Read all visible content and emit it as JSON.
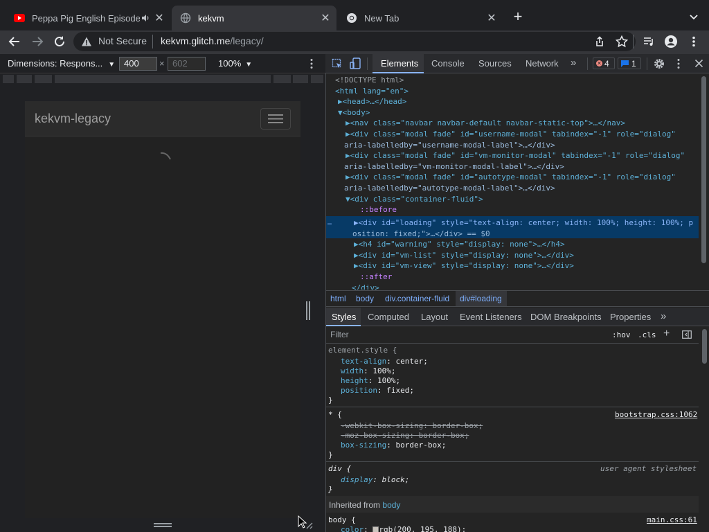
{
  "tabs": [
    {
      "title": "Peppa Pig English Episode",
      "icon": "youtube-icon"
    },
    {
      "title": "kekvm",
      "icon": "globe-icon"
    },
    {
      "title": "New Tab",
      "icon": "chrome-icon"
    }
  ],
  "address": {
    "security": "Not Secure",
    "host": "kekvm.glitch.me",
    "path": "/legacy/"
  },
  "device_toolbar": {
    "dimensions_label": "Dimensions: Respons...",
    "width": "400",
    "height_placeholder": "602",
    "times": "×",
    "zoom": "100%"
  },
  "page": {
    "brand": "kekvm-legacy"
  },
  "devtools": {
    "tabs": [
      "Elements",
      "Console",
      "Sources",
      "Network"
    ],
    "more": "»",
    "errors_count": "4",
    "messages_count": "1",
    "dom_lines": [
      {
        "text": "<!DOCTYPE html>"
      },
      {
        "text": "<html lang=\"en\">"
      },
      {
        "text": "▶<head>…</head>"
      },
      {
        "text": "▼<body>"
      },
      {
        "text": "▶<nav class=\"navbar navbar-default navbar-static-top\">…</nav>"
      },
      {
        "text": "▶<div class=\"modal fade\" id=\"username-modal\" tabindex=\"-1\" role=\"dialog\""
      },
      {
        "text": "aria-labelledby=\"username-modal-label\">…</div>"
      },
      {
        "text": "▶<div class=\"modal fade\" id=\"vm-monitor-modal\" tabindex=\"-1\" role=\"dialog\""
      },
      {
        "text": "aria-labelledby=\"vm-monitor-modal-label\">…</div>"
      },
      {
        "text": "▶<div class=\"modal fade\" id=\"autotype-modal\" tabindex=\"-1\" role=\"dialog\""
      },
      {
        "text": "aria-labelledby=\"autotype-modal-label\">…</div>"
      },
      {
        "text": "▼<div class=\"container-fluid\">"
      },
      {
        "text": "::before"
      },
      {
        "text": "▶<div id=\"loading\" style=\"text-align: center; width: 100%; height: 100%; p"
      },
      {
        "text": "osition: fixed;\">…</div> == $0"
      },
      {
        "text": "▶<h4 id=\"warning\" style=\"display: none\">…</h4>"
      },
      {
        "text": "▶<div id=\"vm-list\" style=\"display: none\">…</div>"
      },
      {
        "text": "▶<div id=\"vm-view\" style=\"display: none\">…</div>"
      },
      {
        "text": "::after"
      },
      {
        "text": "</div>"
      }
    ],
    "breadcrumbs": [
      "html",
      "body",
      "div.container-fluid",
      "div#loading"
    ],
    "subtabs": [
      "Styles",
      "Computed",
      "Layout",
      "Event Listeners",
      "DOM Breakpoints",
      "Properties"
    ],
    "filter_placeholder": "Filter",
    "hov": ":hov",
    "cls": ".cls",
    "plus": "+",
    "rules": {
      "element_style": {
        "selector": "element.style {",
        "props": [
          {
            "name": "text-align",
            "value": "center;"
          },
          {
            "name": "width",
            "value": "100%;"
          },
          {
            "name": "height",
            "value": "100%;"
          },
          {
            "name": "position",
            "value": "fixed;"
          }
        ]
      },
      "star": {
        "selector": "* {",
        "source": "bootstrap.css:1062",
        "props": [
          {
            "text": "-webkit-box-sizing: border-box;"
          },
          {
            "text": "-moz-box-sizing: border-box;"
          },
          {
            "name": "box-sizing",
            "value": "border-box;"
          }
        ]
      },
      "div": {
        "selector": "div {",
        "source": "user agent stylesheet",
        "props": [
          {
            "name": "display",
            "value": "block;"
          }
        ]
      },
      "inherited_label": "Inherited from",
      "inherited_from": "body",
      "body": {
        "selector": "body {",
        "source": "main.css:61",
        "props": [
          {
            "name": "color",
            "value": "rgb(200, 195, 188);"
          }
        ]
      },
      "close_brace": "}"
    }
  },
  "colors": {
    "accent": "#8ab4f8",
    "selection": "#073a66",
    "error": "#f28b82"
  }
}
